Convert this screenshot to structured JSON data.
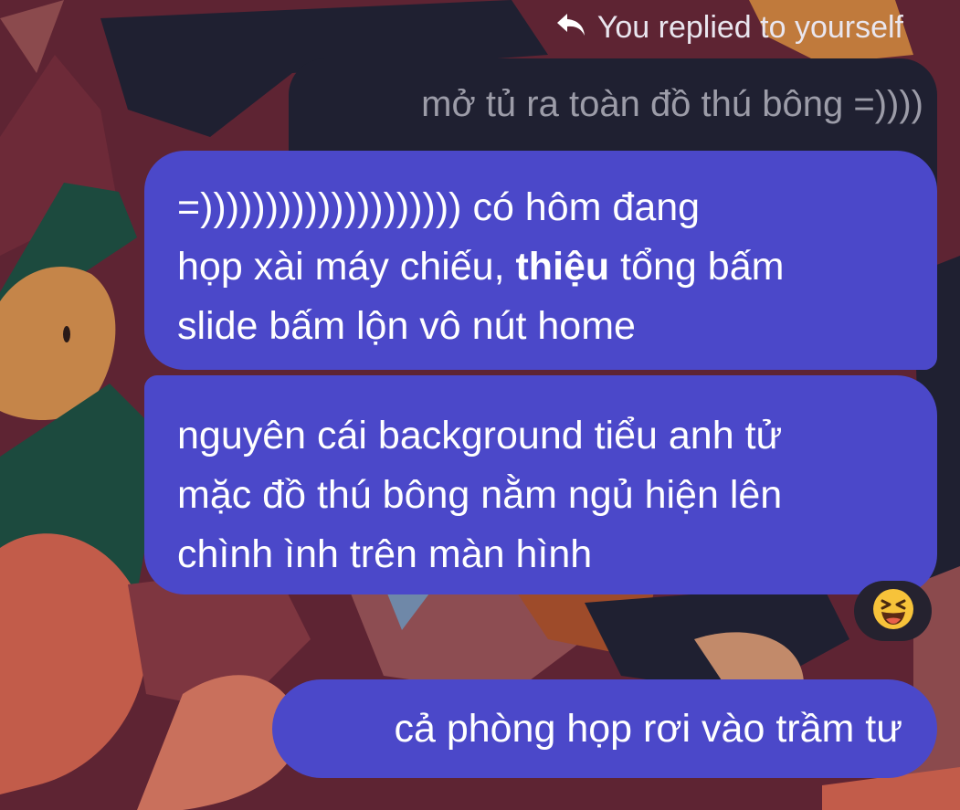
{
  "reply_header": {
    "text": "You replied to yourself",
    "icon": "reply-arrow-icon"
  },
  "quoted_message": {
    "text": "mở tủ ra toàn đồ thú bông =))))"
  },
  "messages": [
    {
      "lines": [
        [
          {
            "text": "=)))))))))))))))))))) có hôm đang"
          }
        ],
        [
          {
            "text": "họp xài máy chiếu, "
          },
          {
            "text": "thiệu",
            "bold": true
          },
          {
            "text": " tổng bấm"
          }
        ],
        [
          {
            "text": "slide bấm lộn vô nút home"
          }
        ]
      ]
    },
    {
      "lines": [
        [
          {
            "text": "nguyên cái background tiểu anh tử"
          }
        ],
        [
          {
            "text": "mặc đồ thú bông nằm ngủ hiện lên"
          }
        ],
        [
          {
            "text": "chình ình trên màn hình"
          }
        ]
      ],
      "reaction": {
        "emoji": "😆",
        "icon": "laughing-face-icon"
      }
    },
    {
      "lines": [
        [
          {
            "text": "cả phòng họp rơi vào trầm tư"
          }
        ]
      ]
    }
  ],
  "colors": {
    "bubble": "#4b48c9",
    "quoted_bubble": "#1f2031",
    "reaction_bg": "#25222f",
    "wallpaper_base": "#5e2433"
  }
}
